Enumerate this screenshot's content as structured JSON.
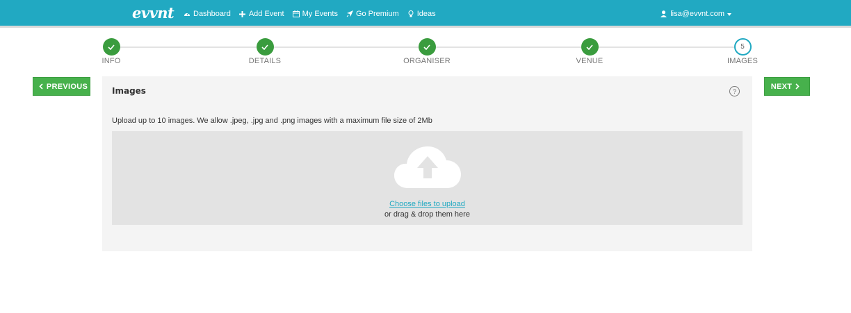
{
  "brand": {
    "logo_text": "evvnt",
    "accent": "#21a9c2",
    "done": "#3a9c3e",
    "button": "#47b14c"
  },
  "nav": {
    "items": [
      {
        "label": "Dashboard",
        "icon": "dashboard-icon"
      },
      {
        "label": "Add Event",
        "icon": "plus-icon"
      },
      {
        "label": "My Events",
        "icon": "calendar-icon"
      },
      {
        "label": "Go Premium",
        "icon": "rocket-icon"
      },
      {
        "label": "Ideas",
        "icon": "lightbulb-icon"
      }
    ],
    "user_email": "lisa@evvnt.com"
  },
  "stepper": {
    "steps": [
      {
        "label": "INFO",
        "state": "done"
      },
      {
        "label": "DETAILS",
        "state": "done"
      },
      {
        "label": "ORGANISER",
        "state": "done"
      },
      {
        "label": "VENUE",
        "state": "done"
      },
      {
        "label": "IMAGES",
        "state": "current",
        "number": "5"
      }
    ]
  },
  "buttons": {
    "previous": "PREVIOUS",
    "next": "NEXT"
  },
  "panel": {
    "title": "Images",
    "help": "?",
    "description": "Upload up to 10 images. We allow .jpeg, .jpg and .png images with a maximum file size of 2Mb",
    "choose_link": "Choose files to upload",
    "drag_text": "or drag & drop them here"
  }
}
